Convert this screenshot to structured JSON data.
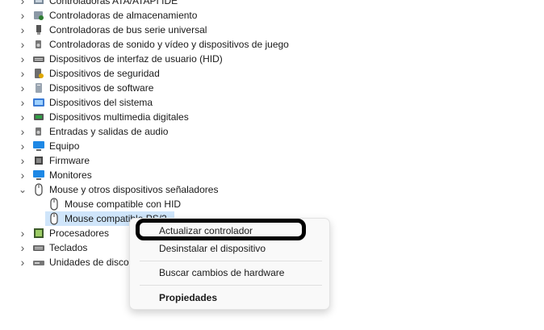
{
  "tree": {
    "items": [
      {
        "label": "Controladoras ATA/ATAPI IDE",
        "expanded": false,
        "icon": "ide-controller-icon"
      },
      {
        "label": "Controladoras de almacenamiento",
        "expanded": false,
        "icon": "storage-controller-icon"
      },
      {
        "label": "Controladoras de bus serie universal",
        "expanded": false,
        "icon": "usb-icon"
      },
      {
        "label": "Controladoras de sonido y vídeo y dispositivos de juego",
        "expanded": false,
        "icon": "speaker-icon"
      },
      {
        "label": "Dispositivos de interfaz de usuario (HID)",
        "expanded": false,
        "icon": "keyboard-icon"
      },
      {
        "label": "Dispositivos de seguridad",
        "expanded": false,
        "icon": "security-device-icon"
      },
      {
        "label": "Dispositivos de software",
        "expanded": false,
        "icon": "software-device-icon"
      },
      {
        "label": "Dispositivos del sistema",
        "expanded": false,
        "icon": "system-folder-icon"
      },
      {
        "label": "Dispositivos multimedia digitales",
        "expanded": false,
        "icon": "multimedia-icon"
      },
      {
        "label": "Entradas y salidas de audio",
        "expanded": false,
        "icon": "speaker-icon"
      },
      {
        "label": "Equipo",
        "expanded": false,
        "icon": "monitor-icon"
      },
      {
        "label": "Firmware",
        "expanded": false,
        "icon": "chip-icon"
      },
      {
        "label": "Monitores",
        "expanded": false,
        "icon": "monitor-icon"
      },
      {
        "label": "Mouse y otros dispositivos señaladores",
        "expanded": true,
        "icon": "mouse-icon",
        "children": [
          {
            "label": "Mouse compatible con HID",
            "icon": "mouse-icon"
          },
          {
            "label": "Mouse compatible PS/2",
            "icon": "mouse-icon",
            "selected": true
          }
        ]
      },
      {
        "label": "Procesadores",
        "expanded": false,
        "icon": "cpu-icon"
      },
      {
        "label": "Teclados",
        "expanded": false,
        "icon": "keyboard-icon"
      },
      {
        "label": "Unidades de disco",
        "expanded": false,
        "icon": "disk-drive-icon"
      }
    ]
  },
  "context_menu": {
    "update_driver": "Actualizar controlador",
    "uninstall_device": "Desinstalar el dispositivo",
    "scan_hardware": "Buscar cambios de hardware",
    "properties": "Propiedades"
  },
  "colors": {
    "selection": "#cfe5fa",
    "highlight_border": "#000000",
    "menu_bg": "#f9f9f9"
  }
}
